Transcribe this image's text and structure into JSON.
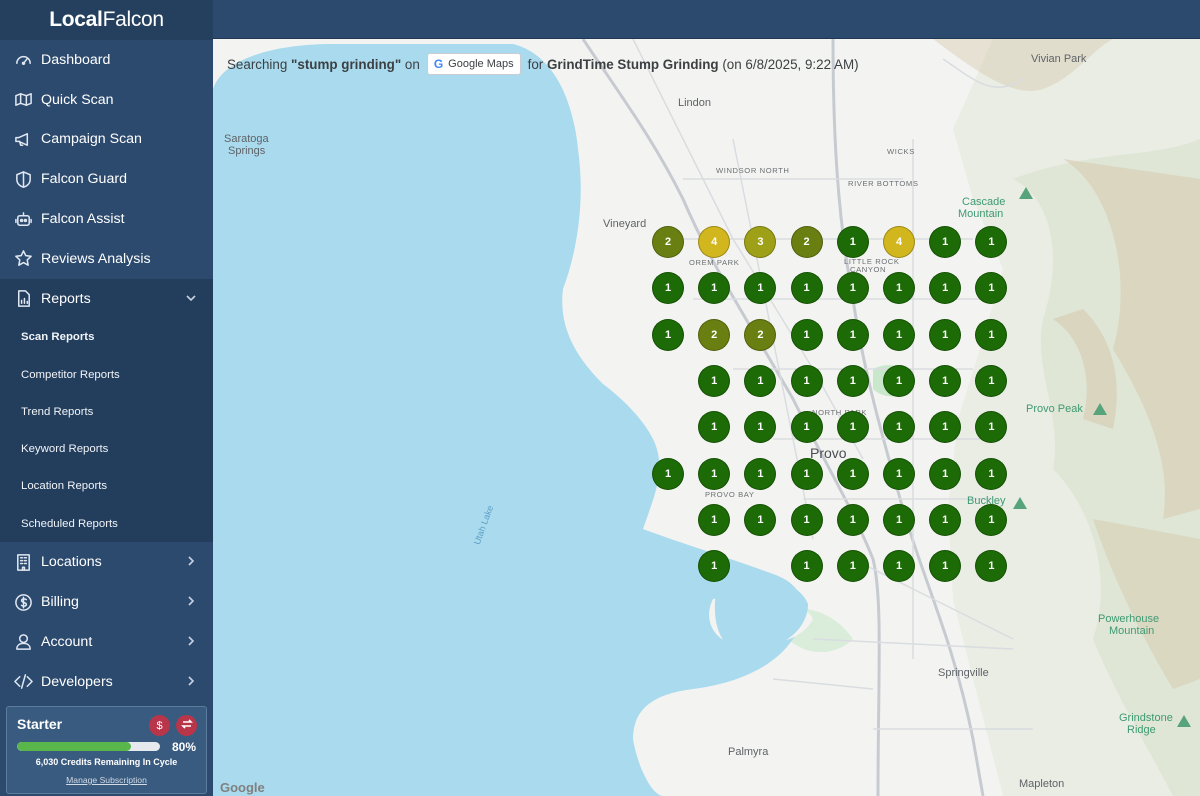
{
  "logo": {
    "bold": "Local",
    "normal": "Falcon"
  },
  "nav": [
    {
      "label": "Dashboard",
      "icon": "gauge-icon"
    },
    {
      "label": "Quick Scan",
      "icon": "map-icon"
    },
    {
      "label": "Campaign Scan",
      "icon": "megaphone-icon"
    },
    {
      "label": "Falcon Guard",
      "icon": "shield-icon"
    },
    {
      "label": "Falcon Assist",
      "icon": "robot-icon"
    },
    {
      "label": "Reviews Analysis",
      "icon": "star-icon"
    },
    {
      "label": "Reports",
      "icon": "chart-file-icon",
      "expanded": true
    }
  ],
  "reports_submenu": [
    {
      "label": "Scan Reports",
      "active": true
    },
    {
      "label": "Competitor Reports"
    },
    {
      "label": "Trend Reports"
    },
    {
      "label": "Keyword Reports"
    },
    {
      "label": "Location Reports"
    },
    {
      "label": "Scheduled Reports"
    }
  ],
  "nav_bottom": [
    {
      "label": "Locations",
      "icon": "building-icon"
    },
    {
      "label": "Billing",
      "icon": "dollar-circle-icon"
    },
    {
      "label": "Account",
      "icon": "user-icon"
    },
    {
      "label": "Developers",
      "icon": "code-icon"
    }
  ],
  "plan": {
    "name": "Starter",
    "usage_percent": 80,
    "usage_label": "80%",
    "credits_text": "6,030 Credits Remaining In Cycle",
    "manage_label": "Manage Subscription",
    "fill_color": "#58b64a"
  },
  "search": {
    "prefix": "Searching",
    "keyword": "\"stump grinding\"",
    "on": "on",
    "platform": "Google Maps",
    "for": "for",
    "business": "GrindTime Stump Grinding",
    "date": "(on 6/8/2025, 9:22 AM)"
  },
  "map_places": {
    "vivian_park": "Vivian Park",
    "lindon": "Lindon",
    "saratoga": "Saratoga",
    "springs": "Springs",
    "windsor_north": "WINDSOR NORTH",
    "wicks": "WICKS",
    "river_bottoms": "RIVER BOTTOMS",
    "cascade": "Cascade",
    "mountain": "Mountain",
    "vineyard": "Vineyard",
    "orem_park": "OREM PARK",
    "little_rock": "LITTLE ROCK",
    "canyon": "CANYON",
    "provo_peak": "Provo Peak",
    "north_park": "NORTH PARK",
    "provo": "Provo",
    "provo_bay": "PROVO BAY",
    "buckley": "Buckley",
    "utah_lake": "Utah Lake",
    "powerhouse": "Powerhouse",
    "springville": "Springville",
    "grindstone": "Grindstone",
    "ridge": "Ridge",
    "palmyra": "Palmyra",
    "mapleton": "Mapleton",
    "google": "Google"
  },
  "rank_colors": {
    "1": "#1c6b06",
    "2": "#6a7f11",
    "3": "#9ea117",
    "4": "#d2b61e"
  },
  "grid_ranks": [
    [
      2,
      4,
      3,
      2,
      1,
      4,
      1,
      1
    ],
    [
      1,
      1,
      1,
      1,
      1,
      1,
      1,
      1
    ],
    [
      1,
      2,
      2,
      1,
      1,
      1,
      1,
      1
    ],
    [
      null,
      1,
      1,
      1,
      1,
      1,
      1,
      1
    ],
    [
      null,
      1,
      1,
      1,
      1,
      1,
      1,
      1
    ],
    [
      1,
      1,
      1,
      1,
      1,
      1,
      1,
      1
    ],
    [
      null,
      1,
      1,
      1,
      1,
      1,
      1,
      1
    ],
    [
      null,
      1,
      null,
      1,
      1,
      1,
      1,
      1
    ]
  ]
}
